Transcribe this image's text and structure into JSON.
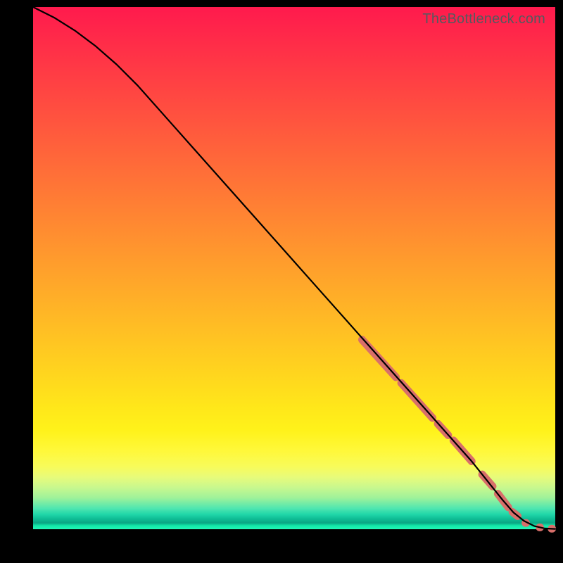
{
  "watermark": "TheBottleneck.com",
  "colors": {
    "dash_stroke": "#d86f6a",
    "line_stroke": "#000000",
    "background": "#000000"
  },
  "chart_data": {
    "type": "line",
    "title": "",
    "xlabel": "",
    "ylabel": "",
    "xlim": [
      0,
      100
    ],
    "ylim": [
      0,
      100
    ],
    "grid": false,
    "axes_visible": false,
    "series": [
      {
        "name": "curve",
        "x": [
          0,
          4,
          8,
          12,
          16,
          20,
          24,
          28,
          32,
          36,
          40,
          44,
          48,
          52,
          56,
          60,
          64,
          68,
          72,
          76,
          80,
          84,
          88,
          90,
          92,
          94,
          96,
          98,
          100
        ],
        "y": [
          100,
          98,
          95.5,
          92.5,
          89,
          85,
          80.5,
          76,
          71.5,
          67,
          62.5,
          58,
          53.5,
          49,
          44.5,
          40,
          35.5,
          31,
          26.5,
          22,
          17.5,
          13,
          8,
          5.5,
          3.2,
          1.6,
          0.6,
          0.15,
          0.05
        ]
      },
      {
        "name": "dash-overlay-segments",
        "note": "thick salmon dashed highlight over lower-right portion of curve",
        "segments": [
          {
            "x": [
              63,
              69.5
            ],
            "y": [
              36.3,
              29.1
            ]
          },
          {
            "x": [
              70.5,
              76.5
            ],
            "y": [
              28.0,
              21.3
            ]
          },
          {
            "x": [
              77.5,
              79.5
            ],
            "y": [
              20.2,
              18.0
            ]
          },
          {
            "x": [
              80.5,
              84.0
            ],
            "y": [
              17.0,
              13.0
            ]
          },
          {
            "x": [
              86.0,
              88.0
            ],
            "y": [
              10.5,
              8.2
            ]
          },
          {
            "x": [
              89.0,
              91.0
            ],
            "y": [
              6.8,
              4.2
            ]
          },
          {
            "x": [
              91.8,
              92.8
            ],
            "y": [
              3.3,
              2.5
            ]
          },
          {
            "x": [
              94.3,
              94.4
            ],
            "y": [
              1.2,
              1.2
            ]
          },
          {
            "x": [
              97.0,
              97.1
            ],
            "y": [
              0.35,
              0.35
            ]
          },
          {
            "x": [
              99.3,
              99.4
            ],
            "y": [
              0.1,
              0.1
            ]
          }
        ]
      }
    ]
  }
}
